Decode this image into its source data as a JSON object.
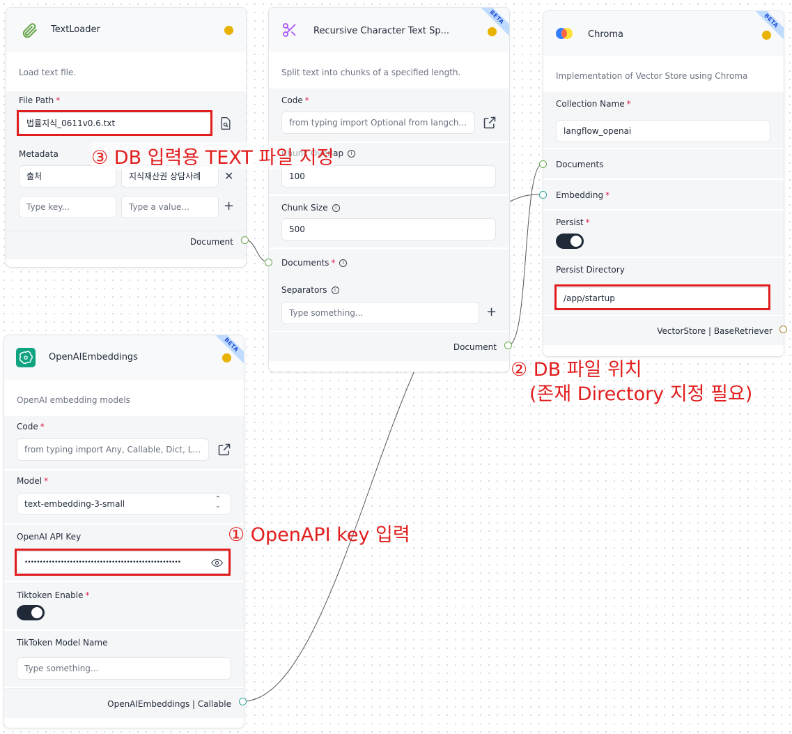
{
  "text_loader": {
    "title": "TextLoader",
    "description": "Load text file.",
    "file_path_label": "File Path",
    "file_path_value": "법률지식_0611v0.6.txt",
    "metadata_label": "Metadata",
    "metadata_key_1": "출처",
    "metadata_value_1": "지식재산권 상담사례",
    "key_placeholder": "Type key...",
    "value_placeholder": "Type a value...",
    "output": "Document"
  },
  "splitter": {
    "title": "Recursive Character Text Sp...",
    "badge": "BETA",
    "description": "Split text into chunks of a specified length.",
    "code_label": "Code",
    "code_value": "from typing import Optional from langchain...",
    "chunk_overlap_label": "Chunk Overlap",
    "chunk_overlap_value": "100",
    "chunk_size_label": "Chunk Size",
    "chunk_size_value": "500",
    "documents_label": "Documents",
    "separators_label": "Separators",
    "separators_placeholder": "Type something...",
    "output": "Document"
  },
  "chroma": {
    "title": "Chroma",
    "badge": "BETA",
    "description": "Implementation of Vector Store using Chroma",
    "collection_label": "Collection Name",
    "collection_value": "langflow_openai",
    "documents_label": "Documents",
    "embedding_label": "Embedding",
    "persist_label": "Persist",
    "persist_on": true,
    "persist_dir_label": "Persist Directory",
    "persist_dir_value": "/app/startup",
    "output": "VectorStore | BaseRetriever"
  },
  "openai": {
    "title": "OpenAIEmbeddings",
    "badge": "BETA",
    "description": "OpenAI embedding models",
    "code_label": "Code",
    "code_value": "from typing import Any, Callable, Dict, List, ...",
    "model_label": "Model",
    "model_value": "text-embedding-3-small",
    "api_key_label": "OpenAI API Key",
    "api_key_value": "••••••••••••••••••••••••••••••••••••••••••••••••••••",
    "tiktoken_label": "Tiktoken Enable",
    "tiktoken_on": true,
    "tiktoken_model_label": "TikToken Model Name",
    "tiktoken_model_placeholder": "Type something...",
    "output": "OpenAIEmbeddings | Callable"
  },
  "annotations": {
    "a1": "① OpenAPI key 입력",
    "a2_line1": "② DB 파일 위치",
    "a2_line2": "(존재 Directory 지정 필요)",
    "a3": "③ DB 입력용 TEXT 파일 지정"
  },
  "colors": {
    "annotation": "#e11d1d",
    "status_dot": "#e8b200",
    "handle_green": "#6aa84f",
    "handle_teal": "#34a39a"
  }
}
